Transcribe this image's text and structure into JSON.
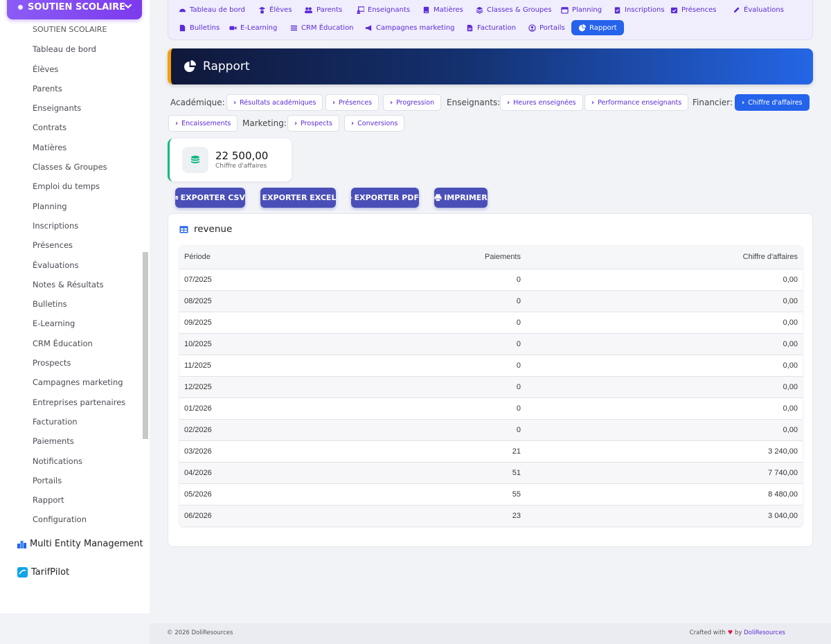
{
  "sidebar": {
    "module_title": "SOUTIEN SCOLAIRE",
    "items": [
      "SOUTIEN SCOLAIRE",
      "Tableau de bord",
      "Élèves",
      "Parents",
      "Enseignants",
      "Contrats",
      "Matières",
      "Classes & Groupes",
      "Emploi du temps",
      "Planning",
      "Inscriptions",
      "Présences",
      "Évaluations",
      "Notes & Résultats",
      "Bulletins",
      "E-Learning",
      "CRM Éducation",
      "Prospects",
      "Campagnes marketing",
      "Entreprises partenaires",
      "Facturation",
      "Paiements",
      "Notifications",
      "Portails",
      "Rapport",
      "Configuration"
    ],
    "section_multi": "Multi Entity Management",
    "section_tarif": "TarifPilot"
  },
  "topnav": {
    "row1": [
      "Tableau de bord",
      "Élèves",
      "Parents",
      "Enseignants",
      "Matières",
      "Classes & Groupes",
      "Planning",
      "Inscriptions",
      "Présences",
      "Évaluations"
    ],
    "row2": [
      "Bulletins",
      "E-Learning",
      "CRM Éducation",
      "Campagnes marketing",
      "Facturation",
      "Portails",
      "Rapport"
    ],
    "active": "Rapport"
  },
  "page": {
    "title": "Rapport"
  },
  "filters": {
    "academique_label": "Académique:",
    "academique": [
      "Résultats académiques",
      "Présences",
      "Progression"
    ],
    "enseignants_label": "Enseignants:",
    "enseignants": [
      "Heures enseignées",
      "Performance enseignants"
    ],
    "financier_label": "Financier:",
    "financier": [
      "Chiffre d'affaires",
      "Encaissements"
    ],
    "marketing_label": "Marketing:",
    "marketing": [
      "Prospects",
      "Conversions"
    ],
    "active": "Chiffre d'affaires"
  },
  "stat": {
    "value": "22 500,00",
    "label": "Chiffre d'affaires"
  },
  "exports": {
    "csv": "EXPORTER CSV",
    "excel": "EXPORTER EXCEL",
    "pdf": "EXPORTER PDF",
    "print": "IMPRIMER"
  },
  "table": {
    "title": "revenue",
    "columns": [
      "Période",
      "Paiements",
      "Chiffre d'affaires"
    ],
    "rows": [
      [
        "07/2025",
        "0",
        "0,00"
      ],
      [
        "08/2025",
        "0",
        "0,00"
      ],
      [
        "09/2025",
        "0",
        "0,00"
      ],
      [
        "10/2025",
        "0",
        "0,00"
      ],
      [
        "11/2025",
        "0",
        "0,00"
      ],
      [
        "12/2025",
        "0",
        "0,00"
      ],
      [
        "01/2026",
        "0",
        "0,00"
      ],
      [
        "02/2026",
        "0",
        "0,00"
      ],
      [
        "03/2026",
        "21",
        "3 240,00"
      ],
      [
        "04/2026",
        "51",
        "7 740,00"
      ],
      [
        "05/2026",
        "55",
        "8 480,00"
      ],
      [
        "06/2026",
        "23",
        "3 040,00"
      ]
    ]
  },
  "footer": {
    "copyright": "© 2026 DoliResources",
    "crafted": "Crafted with",
    "by": "by",
    "brand": "DoliResources"
  },
  "colors": {
    "accent": "#2563eb",
    "purple": "#7c3aed",
    "export": "#4a4fb8",
    "stat_border": "#10b981",
    "banner_border": "#f59e0b"
  }
}
